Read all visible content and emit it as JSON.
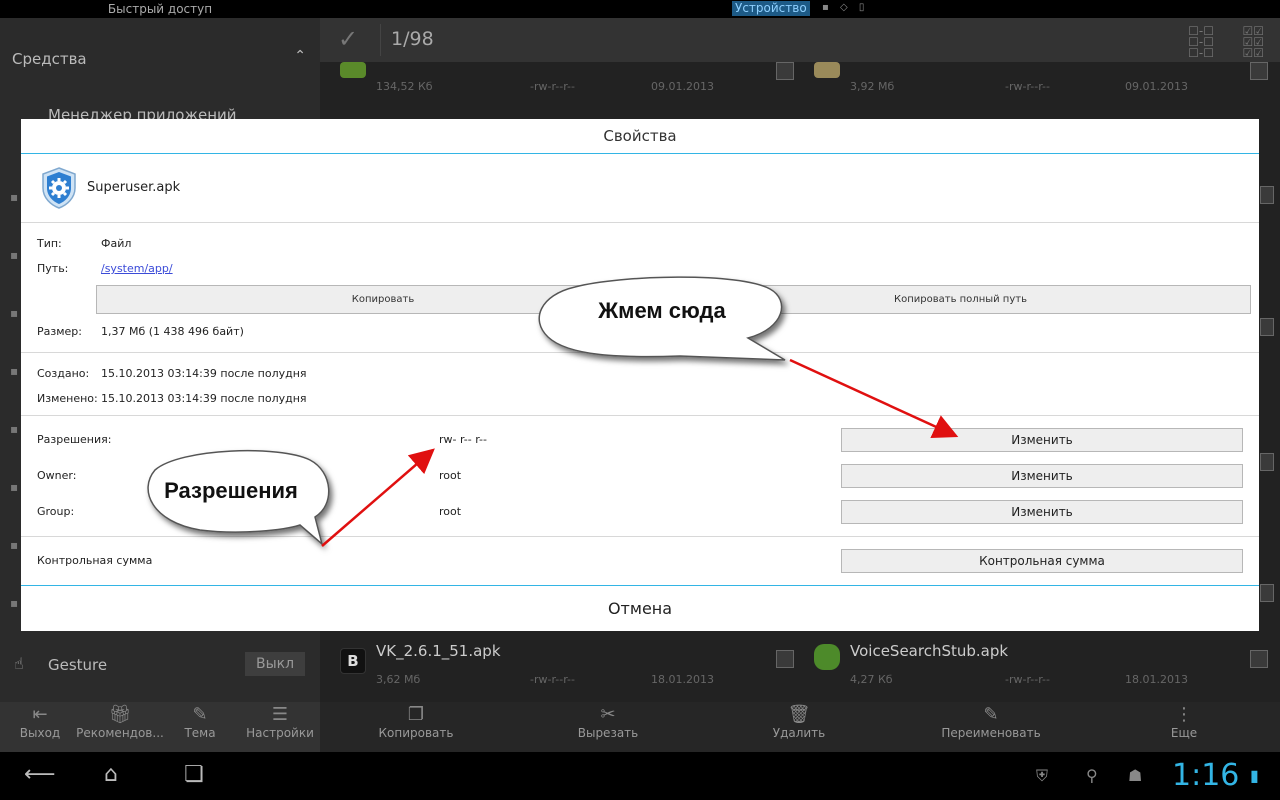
{
  "status_bar": {
    "quick_access": "Быстрый доступ",
    "device_label": "Устройство"
  },
  "sidebar": {
    "section_title": "Средства",
    "app_manager": "Менеджер приложений",
    "gesture_label": "Gesture",
    "gesture_toggle": "Выкл"
  },
  "header": {
    "selection_count": "1/98"
  },
  "files": {
    "top_left_size": "134,52 Кб",
    "top_left_perm": "-rw-r--r--",
    "top_left_date": "09.01.2013",
    "top_right_size": "3,92 Мб",
    "top_right_perm": "-rw-r--r--",
    "top_right_date": "09.01.2013",
    "bottom_left_name": "VK_2.6.1_51.apk",
    "bottom_left_size": "3,62 Мб",
    "bottom_left_perm": "-rw-r--r--",
    "bottom_left_date": "18.01.2013",
    "bottom_right_name": "VoiceSearchStub.apk",
    "bottom_right_size": "4,27 Кб",
    "bottom_right_perm": "-rw-r--r--",
    "bottom_right_date": "18.01.2013"
  },
  "side_toolbar": {
    "exit": "Выход",
    "recommend": "Рекомендов...",
    "theme": "Тема",
    "settings": "Настройки"
  },
  "main_toolbar": {
    "copy": "Копировать",
    "cut": "Вырезать",
    "delete": "Удалить",
    "rename": "Переименовать",
    "more": "Еще"
  },
  "navbar": {
    "clock": "1:16"
  },
  "dialog": {
    "title": "Свойства",
    "file_name": "Superuser.apk",
    "type_label": "Тип:",
    "type_value": "Файл",
    "path_label": "Путь:",
    "path_value": "/system/app/",
    "copy_button": "Копировать",
    "copy_full_path_button": "Копировать полный путь",
    "size_label": "Размер:",
    "size_value": "1,37 Мб (1 438 496 байт)",
    "created_label": "Создано:",
    "created_value": "15.10.2013 03:14:39 после полудня",
    "modified_label": "Изменено:",
    "modified_value": "15.10.2013 03:14:39 после полудня",
    "permissions_label": "Разрешения:",
    "permissions_value": "rw- r-- r--",
    "owner_label": "Owner:",
    "owner_value": "root",
    "group_label": "Group:",
    "group_value": "root",
    "change_button": "Изменить",
    "checksum_label": "Контрольная сумма",
    "checksum_button": "Контрольная сумма",
    "cancel_button": "Отмена"
  },
  "annotations": {
    "callout_top": "Жмем сюда",
    "callout_left": "Разрешения",
    "arrow_color": "#e01010"
  }
}
